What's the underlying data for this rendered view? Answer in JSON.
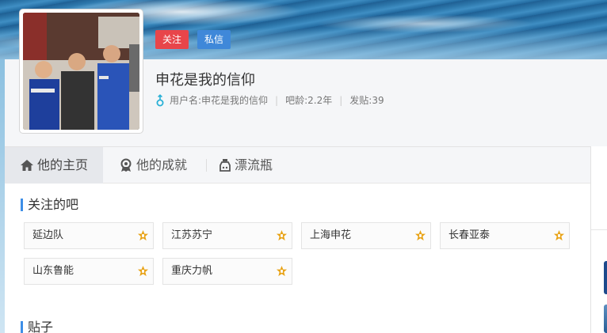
{
  "profile": {
    "username": "申花是我的信仰",
    "follow_label": "关注",
    "message_label": "私信",
    "meta": {
      "name_label": "用户名:申花是我的信仰",
      "age_label": "吧龄:2.2年",
      "posts_label": "发贴:39"
    }
  },
  "tabs": [
    {
      "label": "他的主页",
      "icon": "home-icon",
      "active": true
    },
    {
      "label": "他的成就",
      "icon": "medal-icon",
      "active": false
    },
    {
      "label": "漂流瓶",
      "icon": "bottle-icon",
      "active": false
    }
  ],
  "followed_bars": {
    "title": "关注的吧",
    "items": [
      "延边队",
      "江苏苏宁",
      "上海申花",
      "长春亚泰",
      "山东鲁能",
      "重庆力帆"
    ]
  },
  "posts": {
    "title": "贴子"
  },
  "colors": {
    "follow": "#e8454a",
    "message": "#3f88d9",
    "accent": "#3d8ee7",
    "star": "#e8a317"
  }
}
